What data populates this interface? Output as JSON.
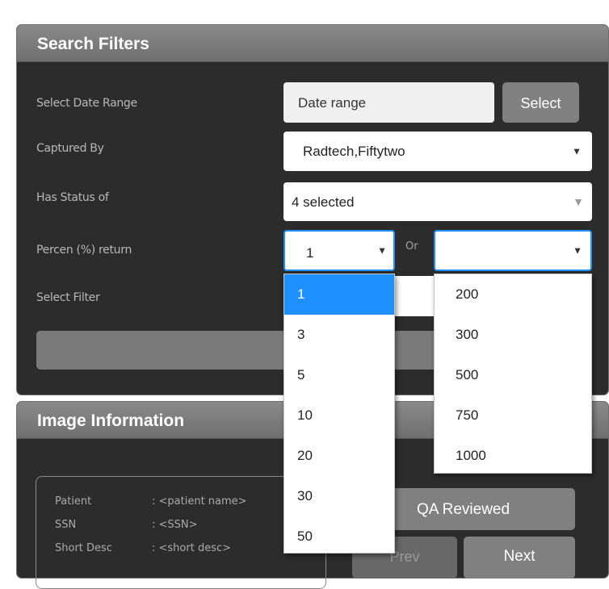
{
  "search_filters": {
    "title": "Search Filters",
    "date_range": {
      "label": "Select Date Range",
      "placeholder": "Date range",
      "select_button": "Select"
    },
    "captured_by": {
      "label": "Captured By",
      "value": "Radtech,Fiftytwo"
    },
    "status": {
      "label": "Has Status of",
      "value": "4 selected"
    },
    "percent_return": {
      "label": "Percen (%) return",
      "value": "1",
      "or_label": "Or",
      "alt_value": "",
      "percent_options": [
        "1",
        "3",
        "5",
        "10",
        "20",
        "30",
        "50"
      ],
      "count_options": [
        "200",
        "300",
        "500",
        "750",
        "1000"
      ]
    },
    "select_filter": {
      "label": "Select Filter"
    }
  },
  "image_information": {
    "title": "Image Information",
    "fields": [
      {
        "label": "Patient",
        "value": ": <patient name>"
      },
      {
        "label": "SSN",
        "value": ": <SSN>"
      },
      {
        "label": "Short Desc",
        "value": ": <short desc>"
      }
    ],
    "qa_reviewed_button": "QA Reviewed",
    "prev_button": "Prev",
    "next_button": "Next"
  },
  "colors": {
    "panel_bg": "#2c2c2c",
    "header_bg": "#7c7c7c",
    "accent_blue": "#1e90ff",
    "button_grey": "#808080"
  }
}
